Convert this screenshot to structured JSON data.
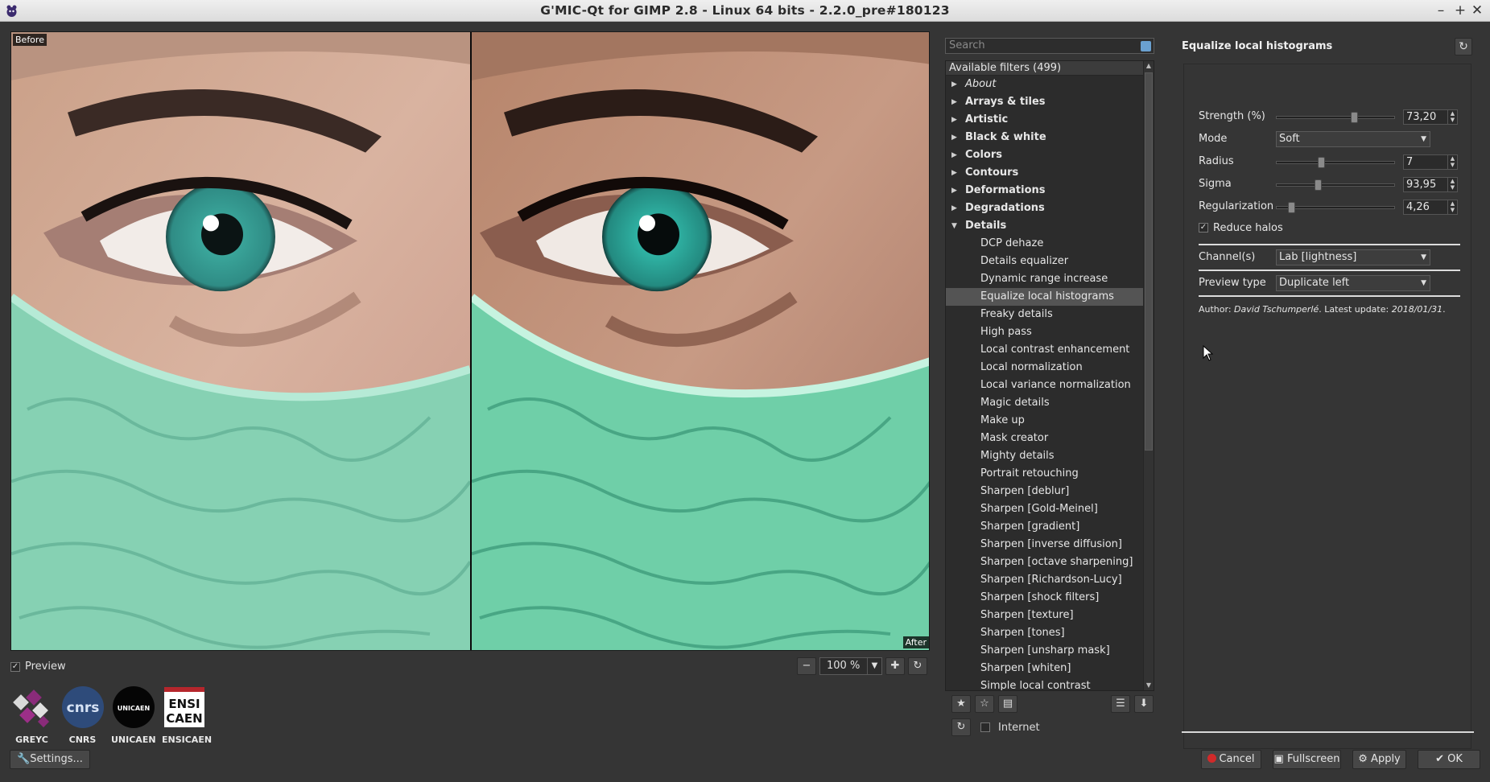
{
  "window": {
    "title": "G'MIC-Qt for GIMP 2.8 - Linux 64 bits - 2.2.0_pre#180123",
    "controls": [
      "–",
      "+",
      "✕"
    ]
  },
  "preview": {
    "before_label": "Before",
    "after_label": "After",
    "checkbox_label": "Preview",
    "checked": true,
    "zoom": "100 %"
  },
  "logos": [
    {
      "name": "GREYC"
    },
    {
      "name": "CNRS",
      "mark_text": "cnrs"
    },
    {
      "name": "UNICAEN",
      "mark_text": "UNICAEN"
    },
    {
      "name": "ENSICAEN",
      "mark_line1": "ENSI",
      "mark_line2": "CAEN"
    }
  ],
  "settings_button": "Settings...",
  "filters": {
    "search_placeholder": "Search",
    "header": "Available filters (499)",
    "items": [
      {
        "label": "About",
        "type": "cat-italic"
      },
      {
        "label": "Arrays & tiles",
        "type": "cat"
      },
      {
        "label": "Artistic",
        "type": "cat"
      },
      {
        "label": "Black & white",
        "type": "cat"
      },
      {
        "label": "Colors",
        "type": "cat"
      },
      {
        "label": "Contours",
        "type": "cat"
      },
      {
        "label": "Deformations",
        "type": "cat"
      },
      {
        "label": "Degradations",
        "type": "cat"
      },
      {
        "label": "Details",
        "type": "cat-open"
      },
      {
        "label": "DCP dehaze",
        "type": "sub"
      },
      {
        "label": "Details equalizer",
        "type": "sub"
      },
      {
        "label": "Dynamic range increase",
        "type": "sub"
      },
      {
        "label": "Equalize local histograms",
        "type": "sub-selected"
      },
      {
        "label": "Freaky details",
        "type": "sub"
      },
      {
        "label": "High pass",
        "type": "sub"
      },
      {
        "label": "Local contrast enhancement",
        "type": "sub"
      },
      {
        "label": "Local normalization",
        "type": "sub"
      },
      {
        "label": "Local variance normalization",
        "type": "sub"
      },
      {
        "label": "Magic details",
        "type": "sub"
      },
      {
        "label": "Make up",
        "type": "sub"
      },
      {
        "label": "Mask creator",
        "type": "sub"
      },
      {
        "label": "Mighty details",
        "type": "sub"
      },
      {
        "label": "Portrait retouching",
        "type": "sub"
      },
      {
        "label": "Sharpen [deblur]",
        "type": "sub"
      },
      {
        "label": "Sharpen [Gold-Meinel]",
        "type": "sub"
      },
      {
        "label": "Sharpen [gradient]",
        "type": "sub"
      },
      {
        "label": "Sharpen [inverse diffusion]",
        "type": "sub"
      },
      {
        "label": "Sharpen [octave sharpening]",
        "type": "sub"
      },
      {
        "label": "Sharpen [Richardson-Lucy]",
        "type": "sub"
      },
      {
        "label": "Sharpen [shock filters]",
        "type": "sub"
      },
      {
        "label": "Sharpen [texture]",
        "type": "sub"
      },
      {
        "label": "Sharpen [tones]",
        "type": "sub"
      },
      {
        "label": "Sharpen [unsharp mask]",
        "type": "sub"
      },
      {
        "label": "Sharpen [whiten]",
        "type": "sub"
      },
      {
        "label": "Simple local contrast",
        "type": "sub"
      }
    ],
    "internet_label": "Internet"
  },
  "params": {
    "title": "Equalize local histograms",
    "strength": {
      "label": "Strength (%)",
      "value": "73,20",
      "fraction": 0.66
    },
    "mode": {
      "label": "Mode",
      "value": "Soft"
    },
    "radius": {
      "label": "Radius",
      "value": "7",
      "fraction": 0.37
    },
    "sigma": {
      "label": "Sigma",
      "value": "93,95",
      "fraction": 0.34
    },
    "regularization": {
      "label": "Regularization",
      "value": "4,26",
      "fraction": 0.1
    },
    "reduce_halos": {
      "label": "Reduce halos",
      "checked": true
    },
    "channels": {
      "label": "Channel(s)",
      "value": "Lab [lightness]"
    },
    "preview_type": {
      "label": "Preview type",
      "value": "Duplicate left"
    },
    "author_prefix": "Author: ",
    "author_name": "David Tschumperlé",
    "update_prefix": ". Latest update: ",
    "update_date": "2018/01/31",
    "update_suffix": "."
  },
  "buttons": {
    "cancel": "Cancel",
    "fullscreen": "Fullscreen",
    "apply": "Apply",
    "ok": "OK"
  }
}
